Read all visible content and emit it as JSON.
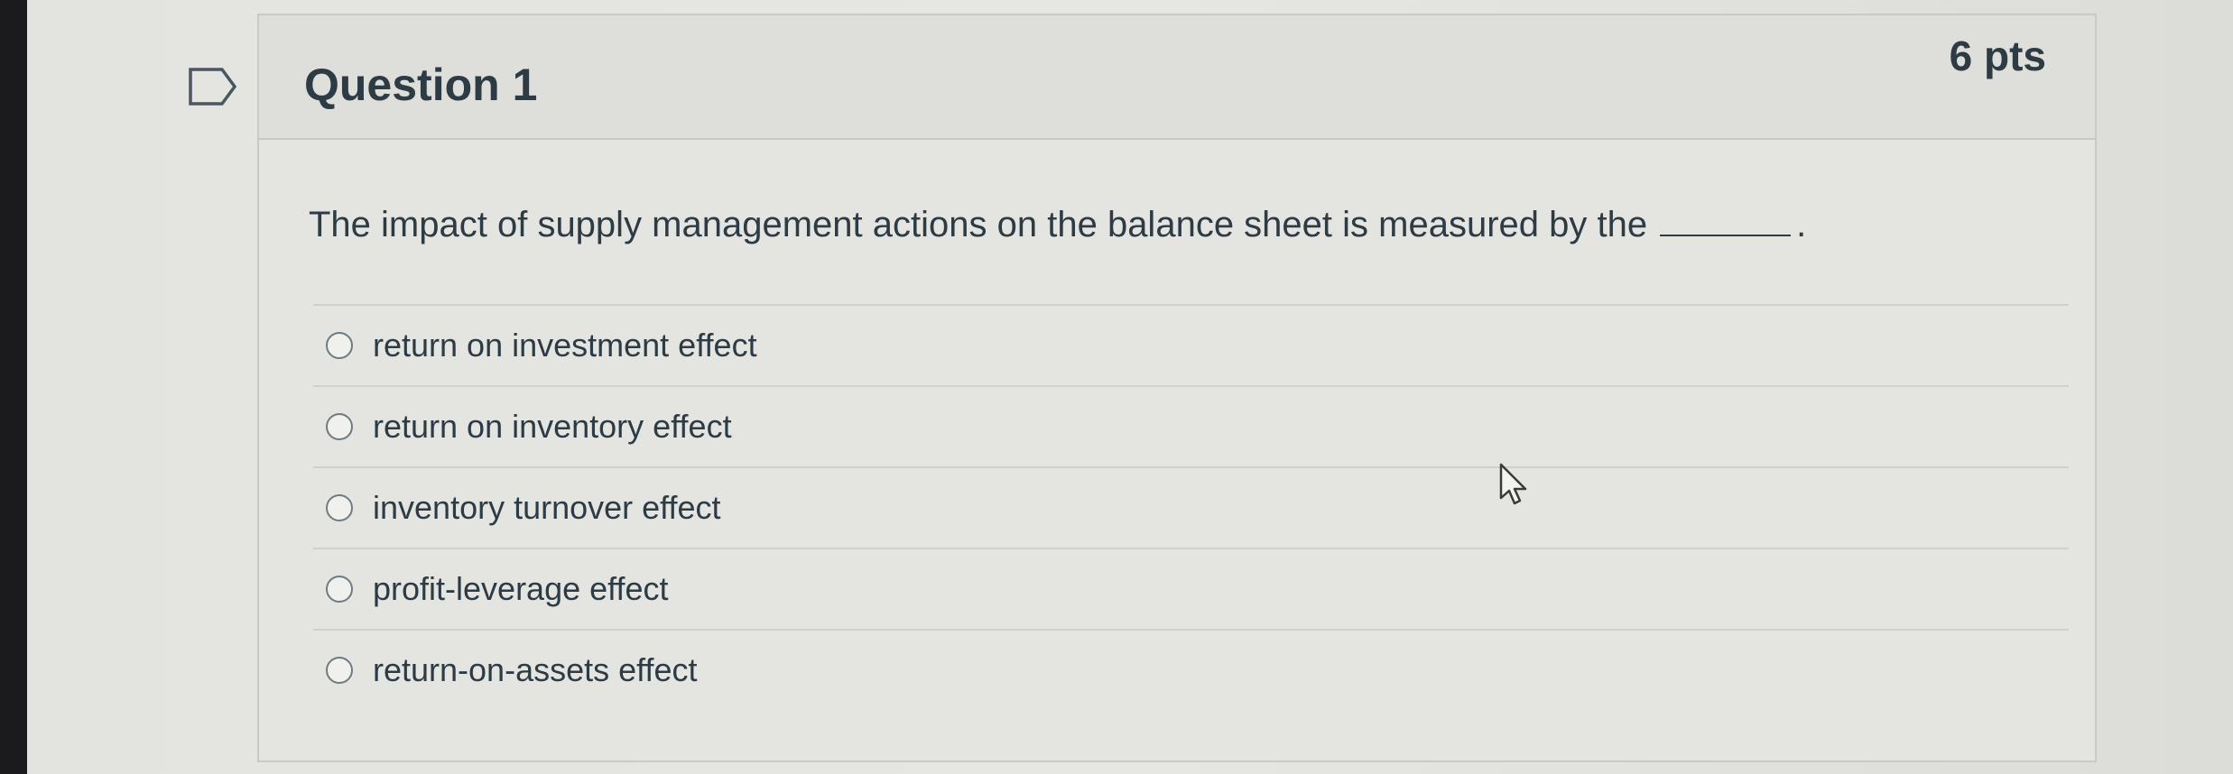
{
  "question": {
    "title": "Question 1",
    "points": "6 pts",
    "prompt": "The impact of supply management actions on the balance sheet is measured by the",
    "prompt_end": ".",
    "answers": [
      {
        "label": "return on investment effect"
      },
      {
        "label": "return on inventory effect"
      },
      {
        "label": "inventory turnover effect"
      },
      {
        "label": "profit-leverage effect"
      },
      {
        "label": "return-on-assets effect"
      }
    ]
  },
  "icons": {
    "flag": "flag-outline-icon",
    "cursor": "mouse-pointer-icon"
  },
  "colors": {
    "text": "#2d3b45",
    "background": "#e4e4e0",
    "border": "#c9c9c5"
  }
}
